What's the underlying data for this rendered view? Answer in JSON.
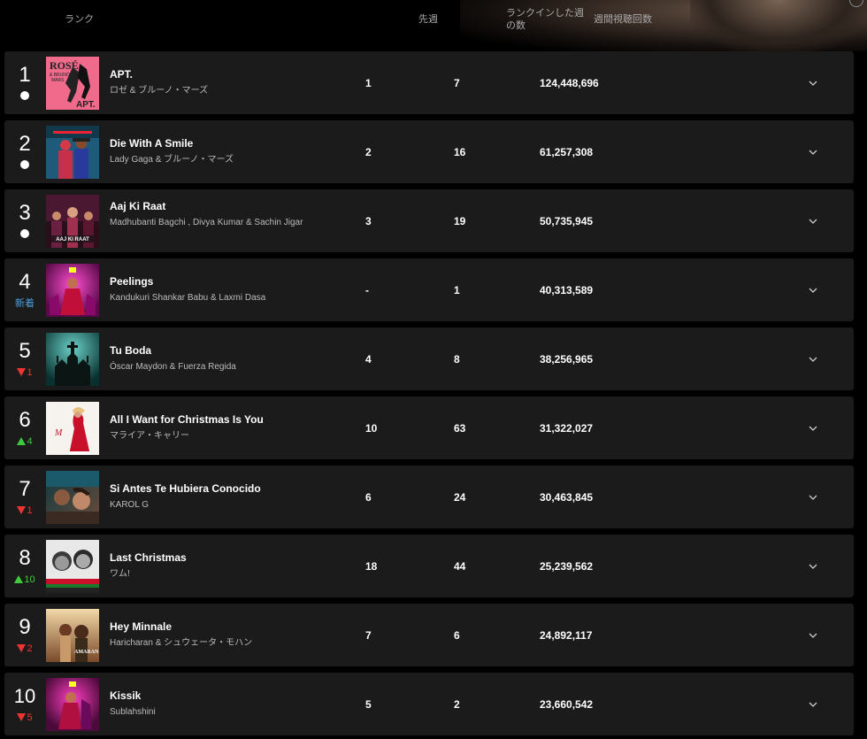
{
  "header": {
    "rank_label": "ランク",
    "prev_week_label": "先週",
    "weeks_label": "ランクインした週の数",
    "weekly_views_label": "週間視聴回数"
  },
  "rows": [
    {
      "rank": "1",
      "status_type": "same",
      "status_text": "",
      "title": "APT.",
      "artist": "ロゼ & ブルーノ・マーズ",
      "prev": "1",
      "weeks": "7",
      "views": "124,448,696",
      "art_icon": "apt-album-art"
    },
    {
      "rank": "2",
      "status_type": "same",
      "status_text": "",
      "title": "Die With A Smile",
      "artist": "Lady Gaga & ブルーノ・マーズ",
      "prev": "2",
      "weeks": "16",
      "views": "61,257,308",
      "art_icon": "die-with-a-smile-album-art"
    },
    {
      "rank": "3",
      "status_type": "same",
      "status_text": "",
      "title": "Aaj Ki Raat",
      "artist": "Madhubanti Bagchi , Divya Kumar & Sachin Jigar",
      "prev": "3",
      "weeks": "19",
      "views": "50,735,945",
      "art_icon": "aaj-ki-raat-album-art"
    },
    {
      "rank": "4",
      "status_type": "new",
      "status_text": "新着",
      "title": "Peelings",
      "artist": "Kandukuri Shankar Babu & Laxmi Dasa",
      "prev": "-",
      "weeks": "1",
      "views": "40,313,589",
      "art_icon": "peelings-album-art"
    },
    {
      "rank": "5",
      "status_type": "down",
      "status_text": "1",
      "title": "Tu Boda",
      "artist": "Óscar Maydon & Fuerza Regida",
      "prev": "4",
      "weeks": "8",
      "views": "38,256,965",
      "art_icon": "tu-boda-album-art"
    },
    {
      "rank": "6",
      "status_type": "up",
      "status_text": "4",
      "title": "All I Want for Christmas Is You",
      "artist": "マライア・キャリー",
      "prev": "10",
      "weeks": "63",
      "views": "31,322,027",
      "art_icon": "christmas-album-art"
    },
    {
      "rank": "7",
      "status_type": "down",
      "status_text": "1",
      "title": "Si Antes Te Hubiera Conocido",
      "artist": "KAROL G",
      "prev": "6",
      "weeks": "24",
      "views": "30,463,845",
      "art_icon": "si-antes-album-art"
    },
    {
      "rank": "8",
      "status_type": "up",
      "status_text": "10",
      "title": "Last Christmas",
      "artist": "ワム!",
      "prev": "18",
      "weeks": "44",
      "views": "25,239,562",
      "art_icon": "last-christmas-album-art"
    },
    {
      "rank": "9",
      "status_type": "down",
      "status_text": "2",
      "title": "Hey Minnale",
      "artist": "Haricharan & シュウェータ・モハン",
      "prev": "7",
      "weeks": "6",
      "views": "24,892,117",
      "art_icon": "hey-minnale-album-art"
    },
    {
      "rank": "10",
      "status_type": "down",
      "status_text": "5",
      "title": "Kissik",
      "artist": "Sublahshini",
      "prev": "5",
      "weeks": "2",
      "views": "23,660,542",
      "art_icon": "kissik-album-art"
    }
  ],
  "colors": {
    "row_bg": "#1b1b1b",
    "up": "#3ecb3e",
    "down": "#ee3333",
    "new": "#4a9fe0"
  }
}
